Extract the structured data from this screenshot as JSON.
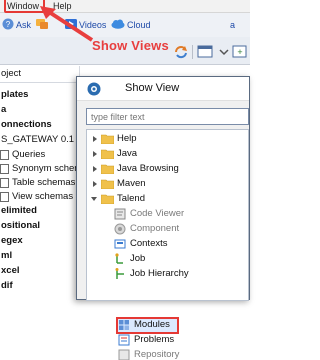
{
  "menubar": {
    "window_label": "Window",
    "help_label": "Help"
  },
  "linkbar": {
    "ask": "Ask",
    "videos": "Videos",
    "cloud": "Cloud",
    "extra": "a"
  },
  "annotation": {
    "callout": "Show Views"
  },
  "left_tree": {
    "items": [
      {
        "label": "oject",
        "bold": false
      },
      {
        "label": "plates",
        "bold": true
      },
      {
        "label": "a",
        "bold": true
      },
      {
        "label": "onnections",
        "bold": true
      },
      {
        "label": "S_GATEWAY 0.1",
        "bold": false
      },
      {
        "label": "Queries",
        "bold": false
      },
      {
        "label": "Synonym schem",
        "bold": false
      },
      {
        "label": "Table schemas",
        "bold": false
      },
      {
        "label": "View schemas",
        "bold": false
      },
      {
        "label": "elimited",
        "bold": true
      },
      {
        "label": "ositional",
        "bold": true
      },
      {
        "label": "egex",
        "bold": true
      },
      {
        "label": "ml",
        "bold": true
      },
      {
        "label": "xcel",
        "bold": true
      },
      {
        "label": "dif",
        "bold": true
      }
    ]
  },
  "dialog": {
    "title": "Show View",
    "filter_placeholder": "type filter text",
    "items": [
      {
        "label": "Help",
        "level": 0,
        "expanded": false,
        "icon": "folder-icon"
      },
      {
        "label": "Java",
        "level": 0,
        "expanded": false,
        "icon": "folder-icon"
      },
      {
        "label": "Java Browsing",
        "level": 0,
        "expanded": false,
        "icon": "folder-icon"
      },
      {
        "label": "Maven",
        "level": 0,
        "expanded": false,
        "icon": "folder-icon"
      },
      {
        "label": "Talend",
        "level": 0,
        "expanded": true,
        "icon": "folder-icon"
      },
      {
        "label": "Code Viewer",
        "level": 1,
        "icon": "code-viewer-icon",
        "disabled": true
      },
      {
        "label": "Component",
        "level": 1,
        "icon": "component-icon",
        "disabled": true
      },
      {
        "label": "Contexts",
        "level": 1,
        "icon": "contexts-icon"
      },
      {
        "label": "Job",
        "level": 1,
        "icon": "job-icon"
      },
      {
        "label": "Job Hierarchy",
        "level": 1,
        "icon": "job-hierarchy-icon"
      },
      {
        "label": "Modules",
        "level": 1,
        "icon": "modules-icon",
        "selected": true
      },
      {
        "label": "Problems",
        "level": 1,
        "icon": "problems-icon"
      },
      {
        "label": "Repository",
        "level": 1,
        "icon": "repository-icon",
        "disabled": true
      }
    ]
  },
  "colors": {
    "highlight": "#e53935",
    "link": "#1e4aa8"
  }
}
